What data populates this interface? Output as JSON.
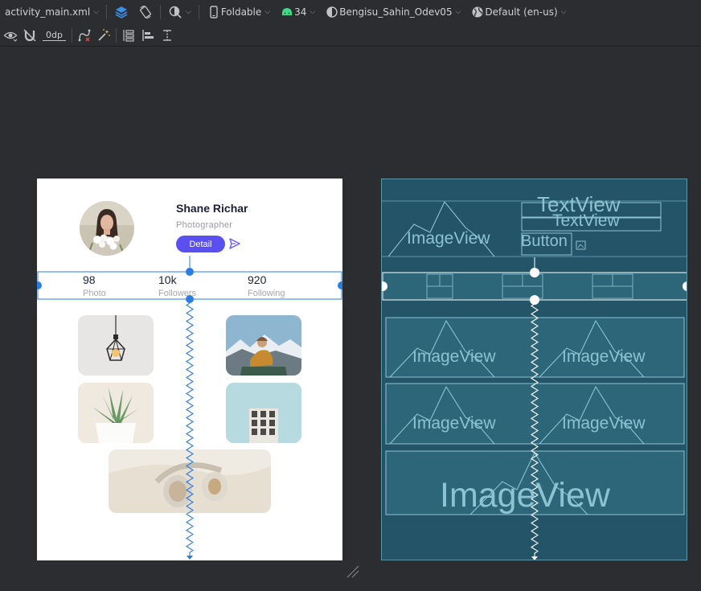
{
  "toolbar_top": {
    "file_tab": "activity_main.xml",
    "device": "Foldable",
    "api_level": "34",
    "theme": "Bengisu_Sahin_Odev05",
    "locale": "Default (en-us)"
  },
  "toolbar_constraint": {
    "margin_value": "0dp"
  },
  "colors": {
    "accent": "#5a4ff0",
    "constraint_blue": "#2a7de1",
    "blueprint_bg": "#245468",
    "blueprint_line": "#8cc3d2",
    "ide_bg": "#2b2d30"
  },
  "design": {
    "name": "Shane Richar",
    "role": "Photographer",
    "detail_button": "Detail",
    "stats": [
      {
        "value": "98",
        "label": "Photo"
      },
      {
        "value": "10k",
        "label": "Followers"
      },
      {
        "value": "920",
        "label": "Following"
      }
    ]
  },
  "blueprint": {
    "textview_1": "TextView",
    "textview_2": "TextView",
    "button": "Button",
    "imageview": "ImageView"
  }
}
